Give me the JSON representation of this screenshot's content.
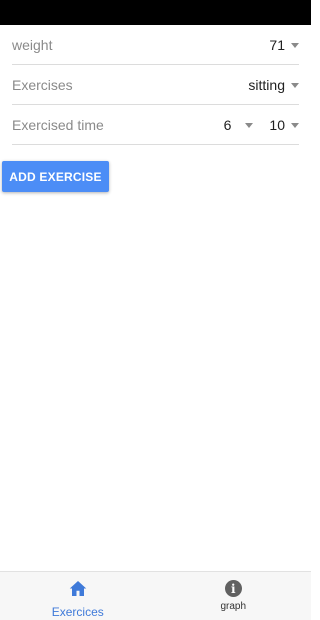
{
  "form": {
    "weight": {
      "label": "weight",
      "value": "71"
    },
    "exercises": {
      "label": "Exercises",
      "value": "sitting"
    },
    "exercised_time": {
      "label": "Exercised time",
      "hours": "6",
      "minutes": "10"
    }
  },
  "add_button_label": "ADD EXERCISE",
  "bottom_nav": {
    "items": [
      {
        "label": "Exercices",
        "icon": "home-icon",
        "active": true
      },
      {
        "label": "graph",
        "icon": "info-icon",
        "active": false
      }
    ]
  },
  "colors": {
    "accent": "#4c8df6",
    "nav_active": "#3f7ad9",
    "status_bar": "#000000"
  }
}
